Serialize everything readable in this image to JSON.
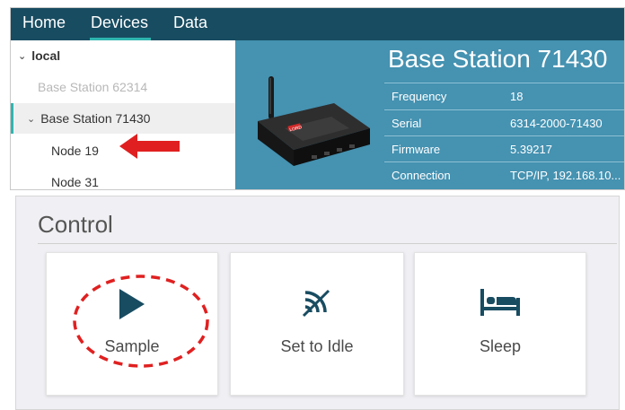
{
  "nav": {
    "items": [
      {
        "label": "Home",
        "active": false
      },
      {
        "label": "Devices",
        "active": true
      },
      {
        "label": "Data",
        "active": false
      }
    ]
  },
  "tree": {
    "local": "local",
    "base_station_1": "Base Station 62314",
    "base_station_2": "Base Station 71430",
    "node_1": "Node 19",
    "node_2": "Node 31"
  },
  "detail": {
    "title": "Base Station 71430",
    "device_brand": "LORD",
    "props": [
      {
        "key": "Frequency",
        "value": "18"
      },
      {
        "key": "Serial",
        "value": "6314-2000-71430"
      },
      {
        "key": "Firmware",
        "value": "5.39217"
      },
      {
        "key": "Connection",
        "value": "TCP/IP, 192.168.10..."
      }
    ]
  },
  "control": {
    "title": "Control",
    "buttons": {
      "sample": "Sample",
      "idle": "Set to Idle",
      "sleep": "Sleep"
    }
  },
  "colors": {
    "navbar": "#184c61",
    "accent": "#2fb6b0",
    "detail_bg": "#4592b1",
    "annotation_red": "#e02020",
    "icon": "#184c61"
  }
}
